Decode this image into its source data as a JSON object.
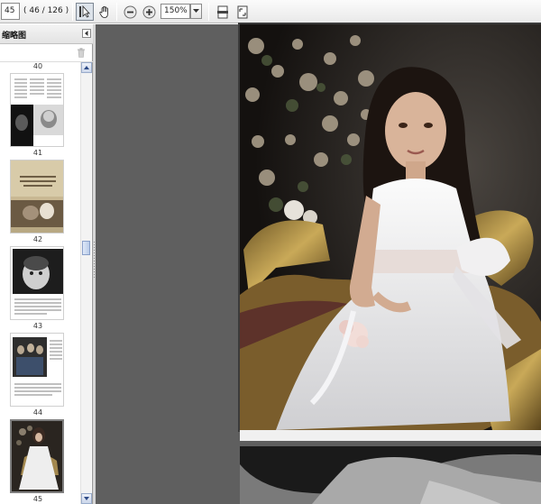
{
  "toolbar": {
    "current_page": "45",
    "page_count": "( 46 / 126 )",
    "zoom": "150%",
    "icons": [
      "select-tool-icon",
      "hand-tool-icon",
      "zoom-out-icon",
      "zoom-in-icon",
      "fit-width-icon",
      "fit-page-icon"
    ]
  },
  "panel": {
    "title": "缩略图",
    "thumbnails": [
      {
        "label": "40"
      },
      {
        "label": "41"
      },
      {
        "label": "42"
      },
      {
        "label": "43"
      },
      {
        "label": "44"
      },
      {
        "label": "45"
      }
    ]
  },
  "colors": {
    "doc_background": "#5f5f5f",
    "scroll_accent": "#b9cbe8"
  }
}
